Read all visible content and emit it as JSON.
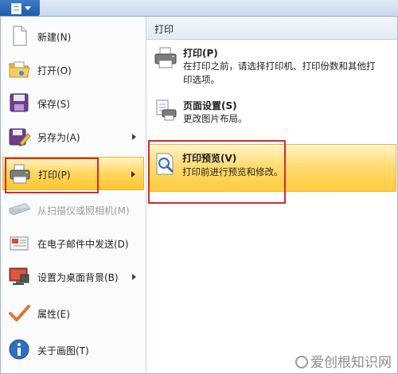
{
  "app_button": {
    "icon": "document-menu-icon"
  },
  "menu": {
    "items": [
      {
        "label": "新建(N)",
        "icon": "new-document-icon",
        "submenu": false
      },
      {
        "label": "打开(O)",
        "icon": "open-folder-icon",
        "submenu": false
      },
      {
        "label": "保存(S)",
        "icon": "save-disk-icon",
        "submenu": false
      },
      {
        "label": "另存为(A)",
        "icon": "save-as-icon",
        "submenu": true
      },
      {
        "label": "打印(P)",
        "icon": "printer-icon",
        "submenu": true,
        "active": true
      },
      {
        "label": "从扫描仪或照相机(M)",
        "icon": "scanner-icon",
        "submenu": false,
        "disabled": true
      },
      {
        "label": "在电子邮件中发送(D)",
        "icon": "email-icon",
        "submenu": false
      },
      {
        "label": "设置为桌面背景(B)",
        "icon": "desktop-background-icon",
        "submenu": true
      },
      {
        "label": "属性(E)",
        "icon": "properties-check-icon",
        "submenu": false
      },
      {
        "label": "关于画图(T)",
        "icon": "info-icon",
        "submenu": false
      }
    ]
  },
  "print_panel": {
    "header": "打印",
    "items": [
      {
        "title": "打印(P)",
        "description": "在打印之前，请选择打印机、打印份数和其他打印选项。",
        "icon": "printer-icon"
      },
      {
        "title": "页面设置(S)",
        "description": "更改图片布局。",
        "icon": "page-setup-icon"
      },
      {
        "title": "打印预览(V)",
        "description": "打印前进行预览和修改。",
        "icon": "print-preview-icon",
        "active": true
      }
    ]
  },
  "watermark": {
    "text": "爱创根知识网"
  },
  "colors": {
    "highlight": "#ffd65f",
    "annotation_red": "#d22b2b",
    "app_button_blue": "#2a66b0"
  }
}
